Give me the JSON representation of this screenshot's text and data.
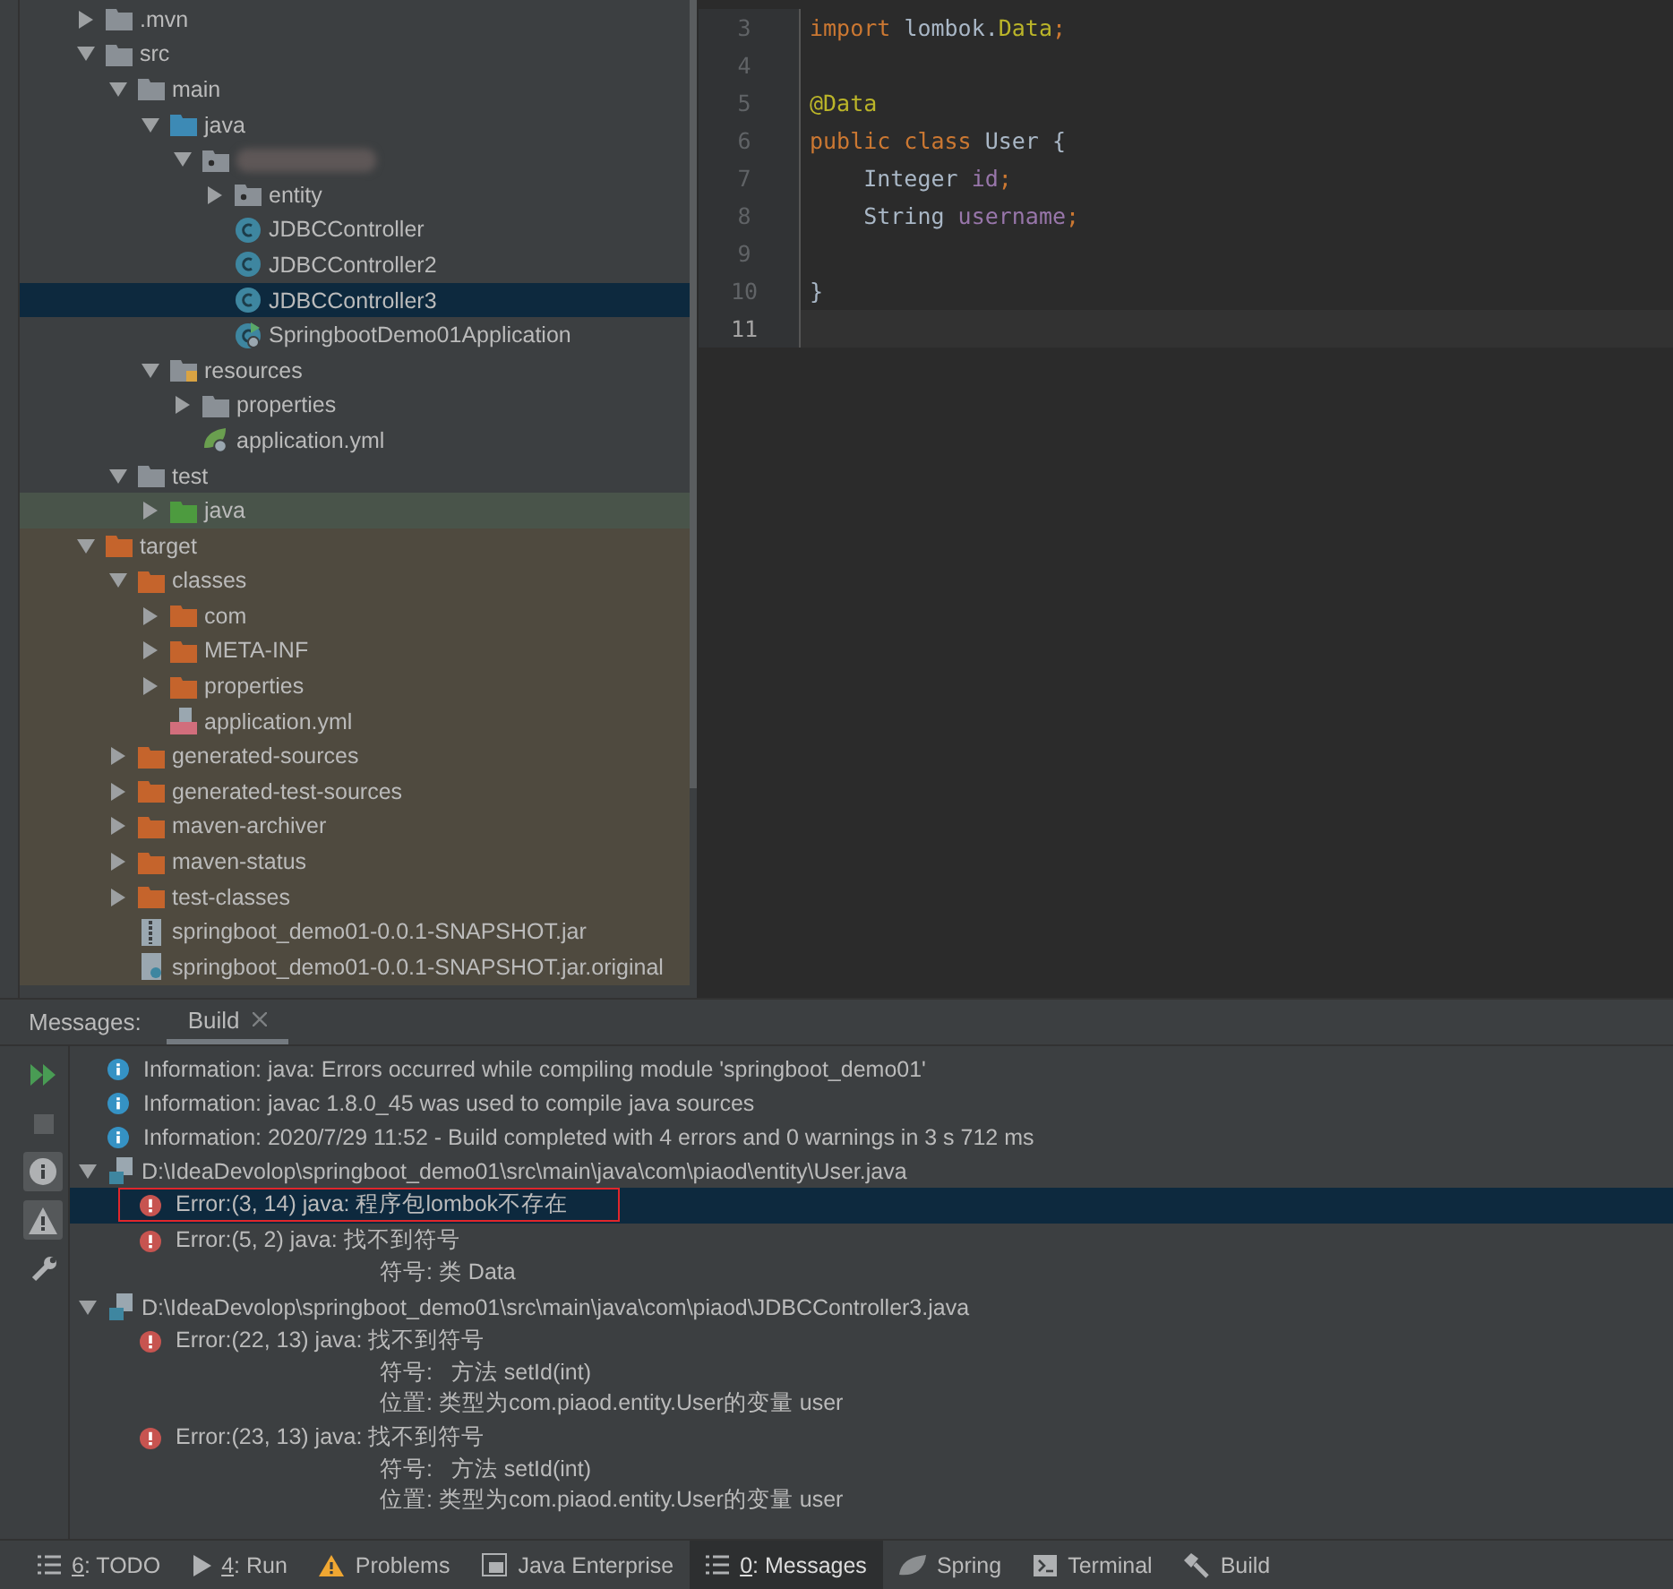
{
  "project_tree": [
    {
      "label": ".mvn",
      "kind": "folder",
      "expanded": false,
      "selected": false,
      "excluded": false
    },
    {
      "label": "src",
      "kind": "folder",
      "expanded": true,
      "selected": false,
      "excluded": false,
      "children": [
        {
          "label": "main",
          "kind": "folder",
          "expanded": true,
          "selected": false,
          "children": [
            {
              "label": "java",
              "kind": "source-folder",
              "expanded": true,
              "selected": false,
              "children": [
                {
                  "kind": "package",
                  "expanded": true,
                  "selected": false,
                  "blurred": true,
                  "children": [
                    {
                      "label": "entity",
                      "kind": "package",
                      "expanded": false,
                      "selected": false
                    },
                    {
                      "label": "JDBCController",
                      "kind": "class",
                      "selected": false
                    },
                    {
                      "label": "JDBCController2",
                      "kind": "class",
                      "selected": false
                    },
                    {
                      "label": "JDBCController3",
                      "kind": "class",
                      "selected": true
                    },
                    {
                      "label": "SpringbootDemo01Application",
                      "kind": "spring-class",
                      "selected": false
                    }
                  ]
                }
              ]
            },
            {
              "label": "resources",
              "kind": "resources-folder",
              "expanded": true,
              "selected": false,
              "children": [
                {
                  "label": "properties",
                  "kind": "folder",
                  "expanded": false,
                  "selected": false
                },
                {
                  "label": "application.yml",
                  "kind": "spring-config",
                  "selected": false
                }
              ]
            }
          ]
        },
        {
          "label": "test",
          "kind": "folder",
          "expanded": true,
          "selected": false,
          "children": [
            {
              "label": "java",
              "kind": "test-folder",
              "expanded": false,
              "selected": false
            }
          ]
        }
      ]
    },
    {
      "label": "target",
      "kind": "excluded-folder",
      "expanded": true,
      "selected": false,
      "excluded": true,
      "children": [
        {
          "label": "classes",
          "kind": "excluded-folder",
          "expanded": true,
          "selected": false,
          "children": [
            {
              "label": "com",
              "kind": "excluded-folder",
              "expanded": false,
              "selected": false
            },
            {
              "label": "META-INF",
              "kind": "excluded-folder",
              "expanded": false,
              "selected": false
            },
            {
              "label": "properties",
              "kind": "excluded-folder",
              "expanded": false,
              "selected": false
            },
            {
              "label": "application.yml",
              "kind": "yml",
              "selected": false
            }
          ]
        },
        {
          "label": "generated-sources",
          "kind": "excluded-folder",
          "expanded": false,
          "selected": false
        },
        {
          "label": "generated-test-sources",
          "kind": "excluded-folder",
          "expanded": false,
          "selected": false
        },
        {
          "label": "maven-archiver",
          "kind": "excluded-folder",
          "expanded": false,
          "selected": false
        },
        {
          "label": "maven-status",
          "kind": "excluded-folder",
          "expanded": false,
          "selected": false
        },
        {
          "label": "test-classes",
          "kind": "excluded-folder",
          "expanded": false,
          "selected": false
        },
        {
          "label": "springboot_demo01-0.0.1-SNAPSHOT.jar",
          "kind": "jar",
          "selected": false
        },
        {
          "label": "springboot_demo01-0.0.1-SNAPSHOT.jar.original",
          "kind": "file",
          "selected": false
        }
      ]
    }
  ],
  "editor": {
    "lines": [
      {
        "number": "3",
        "current": false,
        "tokens": [
          {
            "kind": "keyword",
            "text": "import "
          },
          {
            "kind": "plain",
            "text": "lombok."
          },
          {
            "kind": "annotation",
            "text": "Data"
          },
          {
            "kind": "keyword",
            "text": ";"
          }
        ]
      },
      {
        "number": "4",
        "current": false
      },
      {
        "number": "5",
        "current": false,
        "tokens": [
          {
            "kind": "annotation",
            "text": "@Data"
          }
        ]
      },
      {
        "number": "6",
        "current": false,
        "tokens": [
          {
            "kind": "keyword",
            "text": "public class "
          },
          {
            "kind": "plain",
            "text": "User {"
          }
        ]
      },
      {
        "number": "7",
        "current": false,
        "tokens": [
          {
            "kind": "plain",
            "text": "    Integer "
          },
          {
            "kind": "field",
            "text": "id"
          },
          {
            "kind": "keyword",
            "text": ";"
          }
        ]
      },
      {
        "number": "8",
        "current": false,
        "tokens": [
          {
            "kind": "plain",
            "text": "    String "
          },
          {
            "kind": "field",
            "text": "username"
          },
          {
            "kind": "keyword",
            "text": ";"
          }
        ]
      },
      {
        "number": "9",
        "current": false
      },
      {
        "number": "10",
        "current": false,
        "tokens": [
          {
            "kind": "plain",
            "text": "}"
          }
        ]
      },
      {
        "number": "11",
        "current": true
      }
    ]
  },
  "messages": {
    "title": "Messages:",
    "tabs": [
      {
        "label": "Build",
        "selected": true,
        "closable": true
      }
    ],
    "toolbar": [
      {
        "kind": "rerun",
        "on": false
      },
      {
        "kind": "stop",
        "on": false
      },
      {
        "kind": "info-filter",
        "on": true
      },
      {
        "kind": "warning-filter",
        "on": true
      },
      {
        "kind": "settings",
        "on": false
      }
    ],
    "entries": [
      {
        "kind": "info",
        "text": "Information: java: Errors occurred while compiling module 'springboot_demo01'"
      },
      {
        "kind": "info",
        "text": "Information: javac 1.8.0_45 was used to compile java sources"
      },
      {
        "kind": "info",
        "text": "Information: 2020/7/29 11:52 - Build completed with 4 errors and 0 warnings in 3 s 712 ms"
      },
      {
        "kind": "file",
        "text": "D:\\IdeaDevolop\\springboot_demo01\\src\\main\\java\\com\\piaod\\entity\\User.java",
        "expanded": true,
        "errors": [
          {
            "text": "Error:(3, 14)  java: 程序包lombok不存在",
            "selected": true,
            "marked": true
          },
          {
            "text": "Error:(5, 2)  java: 找不到符号",
            "details": [
              "符号: 类 Data"
            ],
            "selected": false,
            "marked": false
          }
        ]
      },
      {
        "kind": "file",
        "text": "D:\\IdeaDevolop\\springboot_demo01\\src\\main\\java\\com\\piaod\\JDBCController3.java",
        "expanded": true,
        "errors": [
          {
            "text": "Error:(22, 13)  java: 找不到符号",
            "details": [
              "符号:   方法 setId(int)",
              "位置: 类型为com.piaod.entity.User的变量 user"
            ],
            "selected": false,
            "marked": false
          },
          {
            "text": "Error:(23, 13)  java: 找不到符号",
            "details": [
              "符号:   方法 setId(int)",
              "位置: 类型为com.piaod.entity.User的变量 user"
            ],
            "selected": false,
            "marked": false
          }
        ]
      }
    ]
  },
  "tool_tabs": [
    {
      "kind": "list",
      "mnemonic": "6",
      "label": ": TODO",
      "selected": false
    },
    {
      "kind": "run",
      "mnemonic": "4",
      "label": ": Run",
      "selected": false
    },
    {
      "kind": "warning",
      "label": "Problems",
      "selected": false
    },
    {
      "kind": "enterprise",
      "label": "Java Enterprise",
      "selected": false
    },
    {
      "kind": "list",
      "mnemonic": "0",
      "label": ": Messages",
      "selected": true
    },
    {
      "kind": "leaf",
      "label": "Spring",
      "selected": false
    },
    {
      "kind": "terminal",
      "label": "Terminal",
      "selected": false
    },
    {
      "kind": "hammer",
      "label": "Build",
      "selected": false
    }
  ]
}
